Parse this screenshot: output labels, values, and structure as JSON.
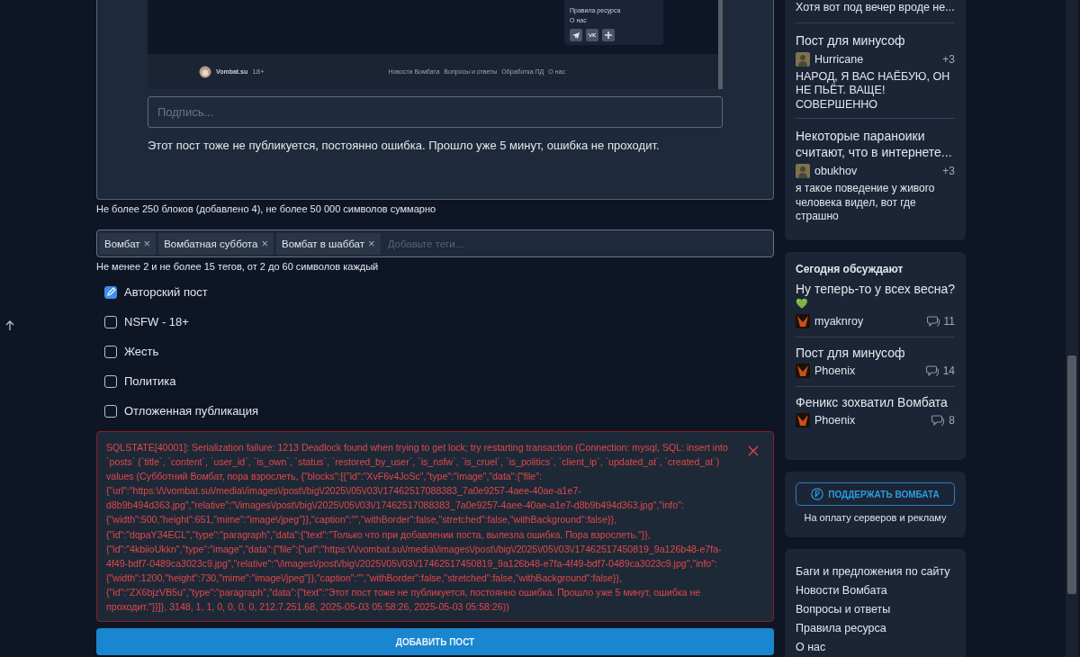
{
  "editor": {
    "image_block": {
      "menu_items": [
        "Правила ресурса",
        "О нас"
      ],
      "social": [
        {
          "kind": "telegram"
        },
        {
          "kind": "vk"
        },
        {
          "kind": "plus"
        }
      ],
      "footer": {
        "site": "Vombat.su",
        "age": "18+",
        "links": [
          "Новости Вомбата",
          "Вопросы и ответы",
          "Обработка ПД",
          "О нас"
        ]
      }
    },
    "caption_placeholder": "Подпись...",
    "paragraph": "Этот пост тоже не публикуется, постоянно ошибка. Прошло уже 5 минут, ошибка не проходит."
  },
  "editor_hint": "Не более 250 блоков (добавлено 4), не более 50 000 символов суммарно",
  "tags": {
    "items": [
      "Вомбат",
      "Вомбатная суббота",
      "Вомбат в шаббат"
    ],
    "remove_glyph": "×",
    "placeholder": "Добавьте теги..."
  },
  "tags_hint": "Не менее 2 и не более 15 тегов, от 2 до 60 символов каждый",
  "options": [
    {
      "label": "Авторский пост",
      "checked": true
    },
    {
      "label": "NSFW - 18+",
      "checked": false
    },
    {
      "label": "Жесть",
      "checked": false
    },
    {
      "label": "Политика",
      "checked": false
    },
    {
      "label": "Отложенная публикация",
      "checked": false
    }
  ],
  "error": {
    "message": "SQLSTATE[40001]: Serialization failure: 1213 Deadlock found when trying to get lock; try restarting transaction (Connection: mysql, SQL: insert into `posts` (`title`, `content`, `user_id`, `is_own`, `status`, `restored_by_user`, `is_nsfw`, `is_cruel`, `is_politics`, `client_ip`, `updated_at`, `created_at`) values (Субботний Вомбат, пора взрослеть, {\"blocks\":[{\"id\":\"XvF6v4JoSc\",\"type\":\"image\",\"data\":{\"file\":{\"url\":\"https:\\/\\/vombat.su\\/media\\/images\\/post\\/big\\/2025\\/05\\/03\\/17462517088383_7a0e9257-4aee-40ae-a1e7-d8b9b494d363.jpg\",\"relative\":\"\\/images\\/post\\/big\\/2025\\/05\\/03\\/17462517088383_7a0e9257-4aee-40ae-a1e7-d8b9b494d363.jpg\",\"info\":{\"width\":500,\"height\":651,\"mime\":\"image\\/jpeg\"}},\"caption\":\"\",\"withBorder\":false,\"stretched\":false,\"withBackground\":false}},{\"id\":\"dqpaY34ECL\",\"type\":\"paragraph\",\"data\":{\"text\":\"Только что при добавлении поста, вылезла ошибка. Пора взрослеть.\"}},{\"id\":\"4kbiioUkkn\",\"type\":\"image\",\"data\":{\"file\":{\"url\":\"https:\\/\\/vombat.su\\/media\\/images\\/post\\/big\\/2025\\/05\\/03\\/17462517450819_9a126b48-e7fa-4f49-bdf7-0489ca3023c9.jpg\",\"relative\":\"\\/images\\/post\\/big\\/2025\\/05\\/03\\/17462517450819_9a126b48-e7fa-4f49-bdf7-0489ca3023c9.jpg\",\"info\":{\"width\":1200,\"height\":730,\"mime\":\"image\\/jpeg\"}},\"caption\":\"\",\"withBorder\":false,\"stretched\":false,\"withBackground\":false}},{\"id\":\"ZX6bjzVB5u\",\"type\":\"paragraph\",\"data\":{\"text\":\"Этот пост тоже не публикуется, постоянно ошибка. Прошло уже 5 минут, ошибка не проходит.\"}}]}, 3148, 1, 1, 0, 0, 0, 0, 212.7.251.68, 2025-05-03 05:58:26, 2025-05-03 05:58:26))"
  },
  "submit_button": "ДОБАВИТЬ ПОСТ",
  "sidebar": {
    "comments": [
      {
        "excerpt": "Хотя вот под вечер вроде не..."
      },
      {
        "title": "Пост для минусоф",
        "author": "Hurricane",
        "score": "+3",
        "excerpt": "НАРОД, Я ВАС НАЁБУЮ, ОН НЕ ПЬЁТ. ВАЩЕ! СОВЕРШЕННО"
      },
      {
        "title": "Некоторые параноики считают, что в интернете...",
        "author": "obukhov",
        "score": "+3",
        "excerpt": "я такое поведение у живого человека видел, вот где страшно"
      }
    ],
    "discussed": {
      "title": "Сегодня обсуждают",
      "items": [
        {
          "title": "Ну теперь-то у всех весна?",
          "emoji": "💚",
          "author": "myaknroy",
          "comments": "11"
        },
        {
          "title": "Пост для минусоф",
          "author": "Phoenix",
          "comments": "14"
        },
        {
          "title": "Феникс зохватил Вомбата",
          "author": "Phoenix",
          "comments": "8"
        }
      ]
    },
    "donate": {
      "button": "ПОДДЕРЖАТЬ ВОМБАТА",
      "note": "На оплату серверов и рекламу"
    },
    "links": [
      "Баги и предложения по сайту",
      "Новости Вомбата",
      "Вопросы и ответы",
      "Правила ресурса",
      "О нас"
    ]
  }
}
